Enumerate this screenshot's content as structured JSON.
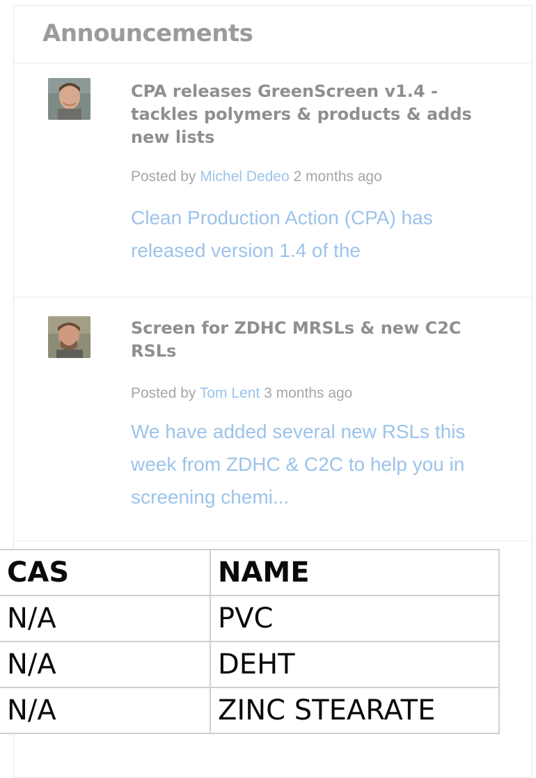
{
  "announcements": {
    "title": "Announcements",
    "posts": [
      {
        "title": "CPA releases GreenScreen v1.4 - tackles polymers & products & adds new lists",
        "posted_by_prefix": "Posted by",
        "author": "Michel Dedeo",
        "time": "2 months ago",
        "excerpt": "Clean Production Action (CPA) has released version 1.4 of the"
      },
      {
        "title": "Screen for ZDHC MRSLs & new C2C RSLs",
        "posted_by_prefix": "Posted by",
        "author": "Tom Lent",
        "time": "3 months ago",
        "excerpt": "We have added several new RSLs this week from ZDHC & C2C to help you in screening chemi..."
      }
    ]
  },
  "table": {
    "headers": [
      "CAS",
      "NAME"
    ],
    "rows": [
      [
        "N/A",
        "PVC"
      ],
      [
        "N/A",
        "DEHT"
      ],
      [
        "N/A",
        "ZINC STEARATE"
      ]
    ]
  },
  "colors": {
    "link": "#9cc3ea",
    "title": "#8f8f8f",
    "meta": "#a6a6a6"
  }
}
